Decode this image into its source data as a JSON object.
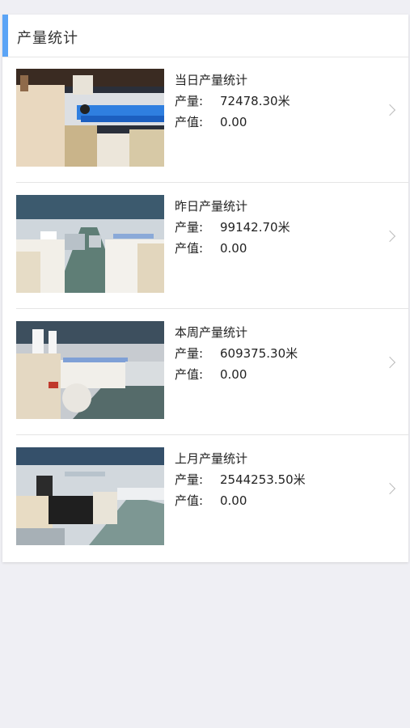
{
  "card": {
    "title": "产量统计"
  },
  "items": [
    {
      "title": "当日产量统计",
      "output_label": "产量:",
      "output_value": "72478.30米",
      "value_label": "产值:",
      "value_value": "0.00"
    },
    {
      "title": "昨日产量统计",
      "output_label": "产量:",
      "output_value": "99142.70米",
      "value_label": "产值:",
      "value_value": "0.00"
    },
    {
      "title": "本周产量统计",
      "output_label": "产量:",
      "output_value": "609375.30米",
      "value_label": "产值:",
      "value_value": "0.00"
    },
    {
      "title": "上月产量统计",
      "output_label": "产量:",
      "output_value": "2544253.50米",
      "value_label": "产值:",
      "value_value": "0.00"
    }
  ],
  "colors": {
    "accent": "#5ba4f6",
    "background": "#efeff4"
  }
}
